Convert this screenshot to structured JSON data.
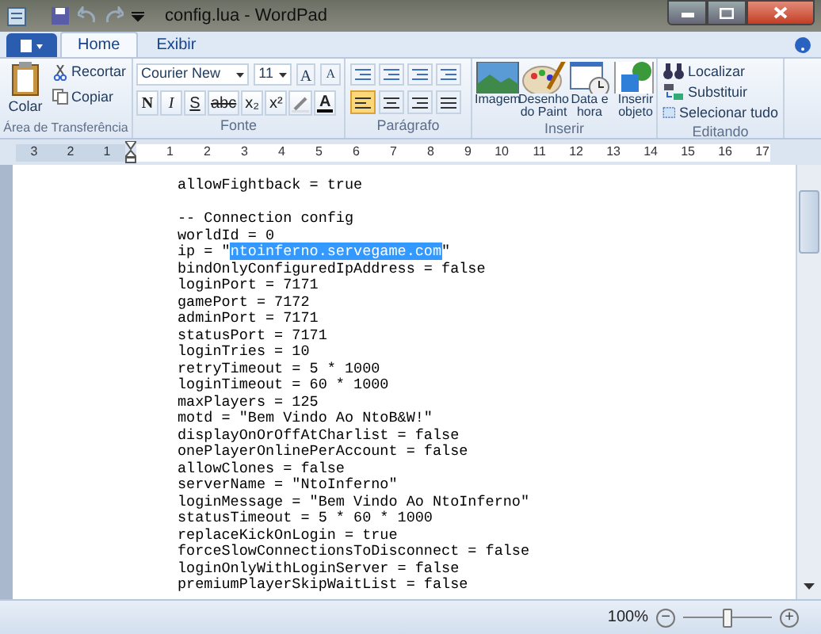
{
  "window": {
    "title": "config.lua - WordPad"
  },
  "tabs": [
    {
      "label": "Home",
      "selected": true
    },
    {
      "label": "Exibir",
      "selected": false
    }
  ],
  "clipboard": {
    "paste": "Colar",
    "cut": "Recortar",
    "copy": "Copiar",
    "label": "Área de Transferência"
  },
  "font": {
    "name": "Courier New",
    "size": "11",
    "grow": "A",
    "shrink": "A",
    "bold": "N",
    "italic": "I",
    "underline": "S",
    "strike": "abc",
    "subscript": "x₂",
    "superscript": "x²",
    "color_letter": "A",
    "label": "Fonte"
  },
  "paragraph": {
    "label": "Parágrafo",
    "alignments": [
      {
        "selected": true
      },
      {
        "selected": false
      },
      {
        "selected": false
      },
      {
        "selected": false
      }
    ]
  },
  "insert": {
    "label": "Inserir",
    "items": [
      {
        "kind": "image",
        "label": "Imagem"
      },
      {
        "kind": "paint",
        "label": "Desenho do Paint"
      },
      {
        "kind": "datetime",
        "label": "Data e hora"
      },
      {
        "kind": "object",
        "label": "Inserir objeto"
      }
    ]
  },
  "editing": {
    "label": "Editando",
    "items": [
      {
        "kind": "find",
        "label": "Localizar"
      },
      {
        "kind": "replace",
        "label": "Substituir"
      },
      {
        "kind": "selectall",
        "label": "Selecionar tudo"
      }
    ]
  },
  "ruler": {
    "left_labels": [
      "3",
      "2",
      "1"
    ],
    "right_labels": [
      "1",
      "2",
      "3",
      "4",
      "5",
      "6",
      "7",
      "8",
      "9",
      "10",
      "11",
      "12",
      "13",
      "14",
      "15",
      "16",
      "17"
    ]
  },
  "document": {
    "lines": [
      {
        "kind": "text",
        "segments": [
          {
            "text": "allowFightback = true",
            "selected": false
          }
        ]
      },
      {
        "kind": "blank"
      },
      {
        "kind": "text",
        "segments": [
          {
            "text": "-- Connection config",
            "selected": false
          }
        ]
      },
      {
        "kind": "text",
        "segments": [
          {
            "text": "worldId = 0",
            "selected": false
          }
        ]
      },
      {
        "kind": "text",
        "segments": [
          {
            "text": "ip = \"",
            "selected": false
          },
          {
            "text": "ntoinferno.servegame.com",
            "selected": true
          },
          {
            "text": "\"",
            "selected": false
          }
        ]
      },
      {
        "kind": "text",
        "segments": [
          {
            "text": "bindOnlyConfiguredIpAddress = false",
            "selected": false
          }
        ]
      },
      {
        "kind": "text",
        "segments": [
          {
            "text": "loginPort = 7171",
            "selected": false
          }
        ]
      },
      {
        "kind": "text",
        "segments": [
          {
            "text": "gamePort = 7172",
            "selected": false
          }
        ]
      },
      {
        "kind": "text",
        "segments": [
          {
            "text": "adminPort = 7171",
            "selected": false
          }
        ]
      },
      {
        "kind": "text",
        "segments": [
          {
            "text": "statusPort = 7171",
            "selected": false
          }
        ]
      },
      {
        "kind": "text",
        "segments": [
          {
            "text": "loginTries = 10",
            "selected": false
          }
        ]
      },
      {
        "kind": "text",
        "segments": [
          {
            "text": "retryTimeout = 5 * 1000",
            "selected": false
          }
        ]
      },
      {
        "kind": "text",
        "segments": [
          {
            "text": "loginTimeout = 60 * 1000",
            "selected": false
          }
        ]
      },
      {
        "kind": "text",
        "segments": [
          {
            "text": "maxPlayers = 125",
            "selected": false
          }
        ]
      },
      {
        "kind": "text",
        "segments": [
          {
            "text": "motd = \"Bem Vindo Ao NtoB&W!\"",
            "selected": false
          }
        ]
      },
      {
        "kind": "text",
        "segments": [
          {
            "text": "displayOnOrOffAtCharlist = false",
            "selected": false
          }
        ]
      },
      {
        "kind": "text",
        "segments": [
          {
            "text": "onePlayerOnlinePerAccount = false",
            "selected": false
          }
        ]
      },
      {
        "kind": "text",
        "segments": [
          {
            "text": "allowClones = false",
            "selected": false
          }
        ]
      },
      {
        "kind": "text",
        "segments": [
          {
            "text": "serverName = \"NtoInferno\"",
            "selected": false
          }
        ]
      },
      {
        "kind": "text",
        "segments": [
          {
            "text": "loginMessage = \"Bem Vindo Ao NtoInferno\"",
            "selected": false
          }
        ]
      },
      {
        "kind": "text",
        "segments": [
          {
            "text": "statusTimeout = 5 * 60 * 1000",
            "selected": false
          }
        ]
      },
      {
        "kind": "text",
        "segments": [
          {
            "text": "replaceKickOnLogin = true",
            "selected": false
          }
        ]
      },
      {
        "kind": "text",
        "segments": [
          {
            "text": "forceSlowConnectionsToDisconnect = false",
            "selected": false
          }
        ]
      },
      {
        "kind": "text",
        "segments": [
          {
            "text": "loginOnlyWithLoginServer = false",
            "selected": false
          }
        ]
      },
      {
        "kind": "text",
        "segments": [
          {
            "text": "premiumPlayerSkipWaitList = false",
            "selected": false
          }
        ]
      }
    ]
  },
  "status_bar": {
    "zoom": "100%",
    "zoom_minus": "−",
    "zoom_plus": "+",
    "level": 0.5
  }
}
